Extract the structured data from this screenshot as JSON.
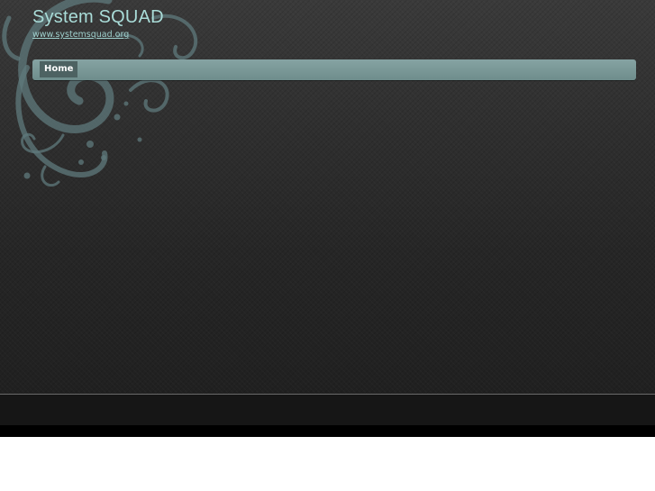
{
  "header": {
    "site_title": "System SQUAD",
    "site_url": "www.systemsquad.org"
  },
  "nav": {
    "items": [
      {
        "label": "Home"
      }
    ]
  },
  "colors": {
    "accent": "#a9dcd8",
    "nav_bar": "#7a9897",
    "nav_active": "#4d6262",
    "background": "#2a2a2a"
  },
  "icons": {
    "decoration": "swirl-ornament-icon"
  }
}
